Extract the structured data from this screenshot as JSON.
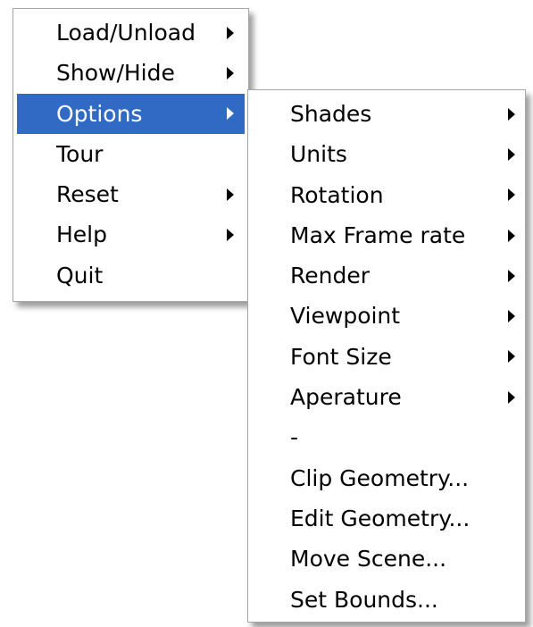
{
  "main_menu": {
    "items": [
      {
        "label": "Load/Unload",
        "has_submenu": true
      },
      {
        "label": "Show/Hide",
        "has_submenu": true
      },
      {
        "label": "Options",
        "has_submenu": true,
        "highlighted": true
      },
      {
        "label": "Tour",
        "has_submenu": false
      },
      {
        "label": "Reset",
        "has_submenu": true
      },
      {
        "label": "Help",
        "has_submenu": true
      },
      {
        "label": "Quit",
        "has_submenu": false
      }
    ]
  },
  "options_submenu": {
    "items": [
      {
        "label": "Shades",
        "has_submenu": true
      },
      {
        "label": "Units",
        "has_submenu": true
      },
      {
        "label": "Rotation",
        "has_submenu": true
      },
      {
        "label": "Max Frame rate",
        "has_submenu": true
      },
      {
        "label": "Render",
        "has_submenu": true
      },
      {
        "label": "Viewpoint",
        "has_submenu": true
      },
      {
        "label": "Font Size",
        "has_submenu": true
      },
      {
        "label": "Aperature",
        "has_submenu": true
      },
      {
        "label": "-",
        "separator": true
      },
      {
        "label": "Clip Geometry...",
        "has_submenu": false
      },
      {
        "label": "Edit Geometry...",
        "has_submenu": false
      },
      {
        "label": "Move Scene...",
        "has_submenu": false
      },
      {
        "label": "Set Bounds...",
        "has_submenu": false
      }
    ]
  },
  "colors": {
    "highlight": "#316ac5",
    "highlight_text": "#ffffff",
    "menu_background": "#ffffff",
    "text": "#000000"
  }
}
